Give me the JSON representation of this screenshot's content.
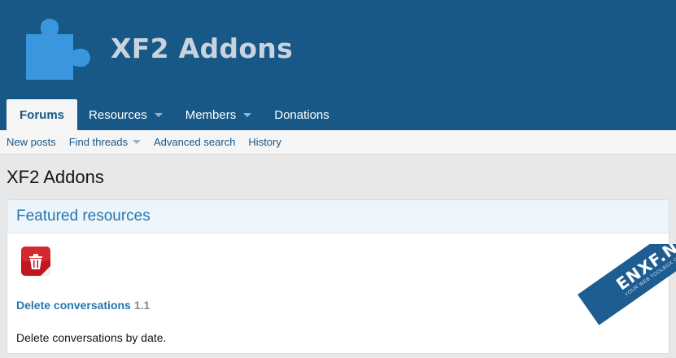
{
  "header": {
    "logo_icon": "puzzle-piece-icon",
    "logo_text": "XF2 Addons"
  },
  "nav": {
    "tabs": [
      {
        "label": "Forums",
        "active": true
      },
      {
        "label": "Resources",
        "has_menu": true
      },
      {
        "label": "Members",
        "has_menu": true
      },
      {
        "label": "Donations"
      }
    ]
  },
  "subnav": {
    "items": [
      {
        "label": "New posts"
      },
      {
        "label": "Find threads",
        "has_menu": true
      },
      {
        "label": "Advanced search"
      },
      {
        "label": "History"
      }
    ]
  },
  "page": {
    "title": "XF2 Addons"
  },
  "featured": {
    "heading": "Featured resources",
    "resource": {
      "icon": "trash-can-icon",
      "title": "Delete conversations",
      "version": "1.1",
      "description": "Delete conversations by date."
    }
  },
  "watermark": {
    "text": "ENXF.NET",
    "subtext": "YOUR WEB TOOLBOX COMMUNITY"
  },
  "colors": {
    "header_bg": "#185886",
    "link": "#2577b1",
    "logo_icon": "#3a96dd",
    "resource_icon": "#c0161c"
  }
}
